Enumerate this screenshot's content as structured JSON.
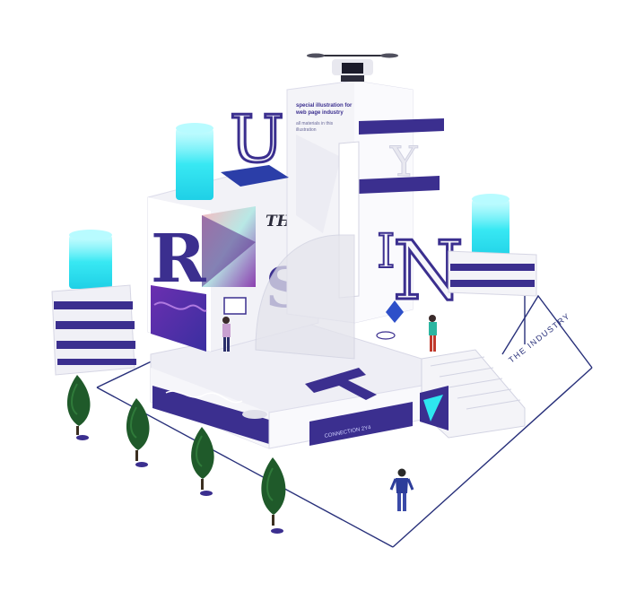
{
  "tagline": {
    "line1": "special illustration for",
    "line2": "web page industry",
    "line3": "all materials in this",
    "line4": "illustration"
  },
  "floor_label": "THE INDUSTRY",
  "tile_label": "THE",
  "side_label": "CONNECTION 2Y4",
  "letters": {
    "u": "U",
    "r": "R",
    "s": "S",
    "t": "T",
    "n": "N",
    "y": "Y",
    "i": "I"
  },
  "colors": {
    "purple": "#3b2f8f",
    "indigo": "#4a3fb3",
    "cyan": "#2ee6f0",
    "white": "#f4f4f8",
    "shadow": "#d9dae6",
    "tree": "#1f5a2a"
  }
}
